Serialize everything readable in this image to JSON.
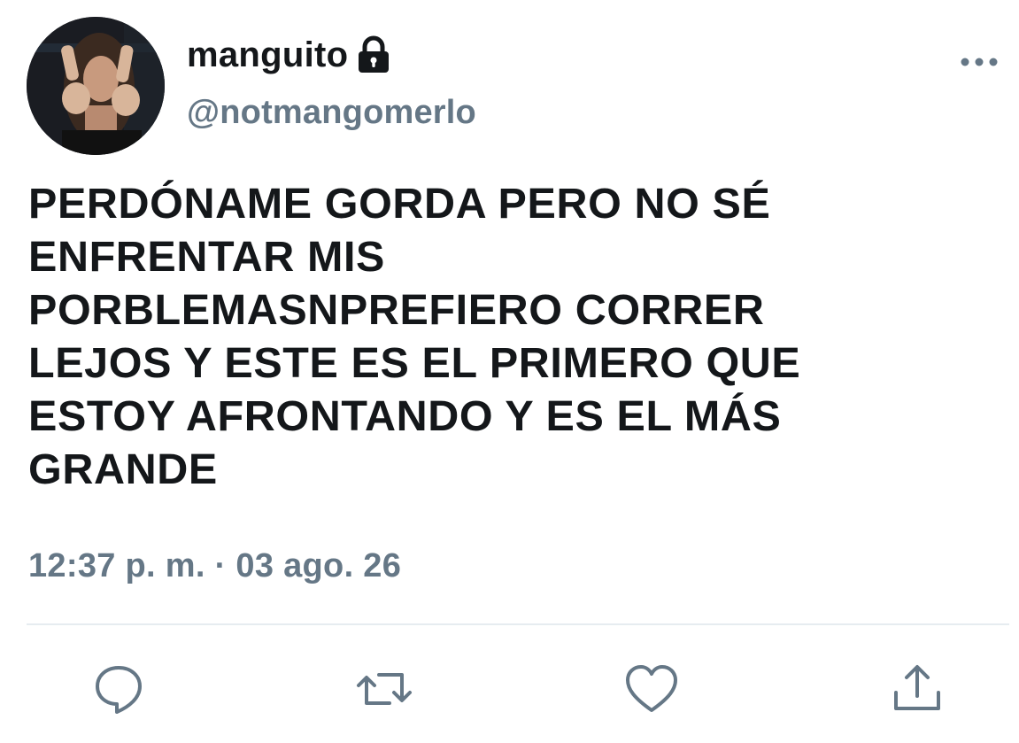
{
  "tweet": {
    "display_name": "manguito",
    "handle": "@notmangomerlo",
    "text": "PERDÓNAME GORDA PERO NO SÉ\nENFRENTAR MIS\nPORBLEMASNPREFIERO CORRER\nLEJOS Y ESTE ES EL PRIMERO QUE\nESTOY AFRONTANDO Y ES EL MÁS\nGRANDE",
    "timestamp": "12:37 p. m. · 03 ago. 26",
    "protected": true
  },
  "icons": {
    "lock": "lock-icon",
    "more": "more-options-icon",
    "reply": "reply-icon",
    "retweet": "retweet-icon",
    "like": "like-icon",
    "share": "share-icon"
  },
  "colors": {
    "text_primary": "#14171a",
    "text_secondary": "#657786",
    "divider": "#e6ecf0"
  }
}
